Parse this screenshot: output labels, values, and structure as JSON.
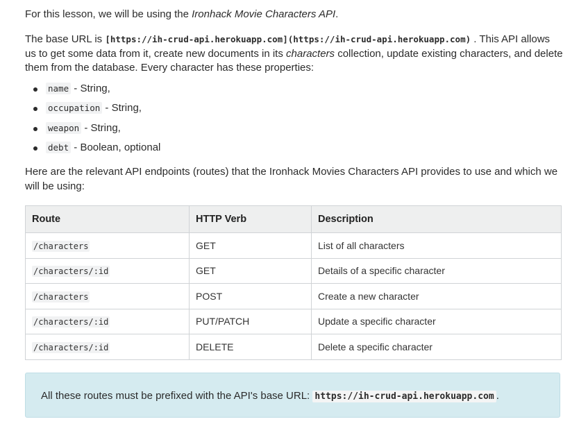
{
  "intro": {
    "prefix": "For this lesson, we will be using the ",
    "api_name": "Ironhack Movie Characters API",
    "suffix": "."
  },
  "base": {
    "prefix": "The base URL is ",
    "url_markdown": "[https://ih-crud-api.herokuapp.com](https://ih-crud-api.herokuapp.com)",
    "middle": " . This API allows us to get some data from it, create new documents in its ",
    "collection": "characters",
    "suffix": " collection, update existing characters, and delete them from the database. Every character has these properties:"
  },
  "properties": [
    {
      "name": "name",
      "desc": " - String,"
    },
    {
      "name": "occupation",
      "desc": " - String,"
    },
    {
      "name": "weapon",
      "desc": " - String,"
    },
    {
      "name": "debt",
      "desc": " - Boolean, optional"
    }
  ],
  "routes_intro": "Here are the relevant API endpoints (routes) that the Ironhack Movies Characters API provides to use and which we will be using:",
  "table": {
    "headers": [
      "Route",
      "HTTP Verb",
      "Description"
    ],
    "rows": [
      {
        "route": "/characters",
        "verb": "GET",
        "description": "List of all characters"
      },
      {
        "route": "/characters/:id",
        "verb": "GET",
        "description": "Details of a specific character"
      },
      {
        "route": "/characters",
        "verb": "POST",
        "description": "Create a new character"
      },
      {
        "route": "/characters/:id",
        "verb": "PUT/PATCH",
        "description": "Update a specific character"
      },
      {
        "route": "/characters/:id",
        "verb": "DELETE",
        "description": "Delete a specific character"
      }
    ]
  },
  "note": {
    "prefix": "All these routes must be prefixed with the API's base URL: ",
    "url": "https://ih-crud-api.herokuapp.com",
    "suffix": "."
  }
}
